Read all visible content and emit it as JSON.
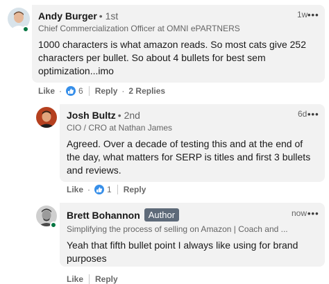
{
  "comments": [
    {
      "name": "Andy Burger",
      "degree": "• 1st",
      "headline": "Chief Commercialization Officer at OMNI ePARTNERS",
      "time": "1w",
      "more": "•••",
      "text": "1000 characters is what amazon reads. So most cats give 252 characters per bullet. So about 4 bullets for best sem optimization...imo",
      "actions": {
        "like": "Like",
        "reaction_count": "6",
        "reply": "Reply",
        "replies": "2 Replies"
      },
      "online": true
    },
    {
      "name": "Josh Bultz",
      "degree": "• 2nd",
      "headline": "CIO / CRO at Nathan James",
      "time": "6d",
      "more": "•••",
      "text": "Agreed. Over a decade of testing this and at the end of the day, what matters for SERP is titles and first 3 bullets and reviews.",
      "actions": {
        "like": "Like",
        "reaction_count": "1",
        "reply": "Reply"
      },
      "online": false
    },
    {
      "name": "Brett Bohannon",
      "badge": "Author",
      "headline": "Simplifying the process of selling on Amazon | Coach and ...",
      "time": "now",
      "more": "•••",
      "text": "Yeah that fifth bullet point I always like using for brand purposes",
      "actions": {
        "like": "Like",
        "reply": "Reply"
      },
      "online": true
    }
  ],
  "colors": {
    "bubble": "#f2f2f2",
    "reaction_blue": "#378fe9",
    "online_green": "#057642",
    "badge": "#5e6a79"
  }
}
